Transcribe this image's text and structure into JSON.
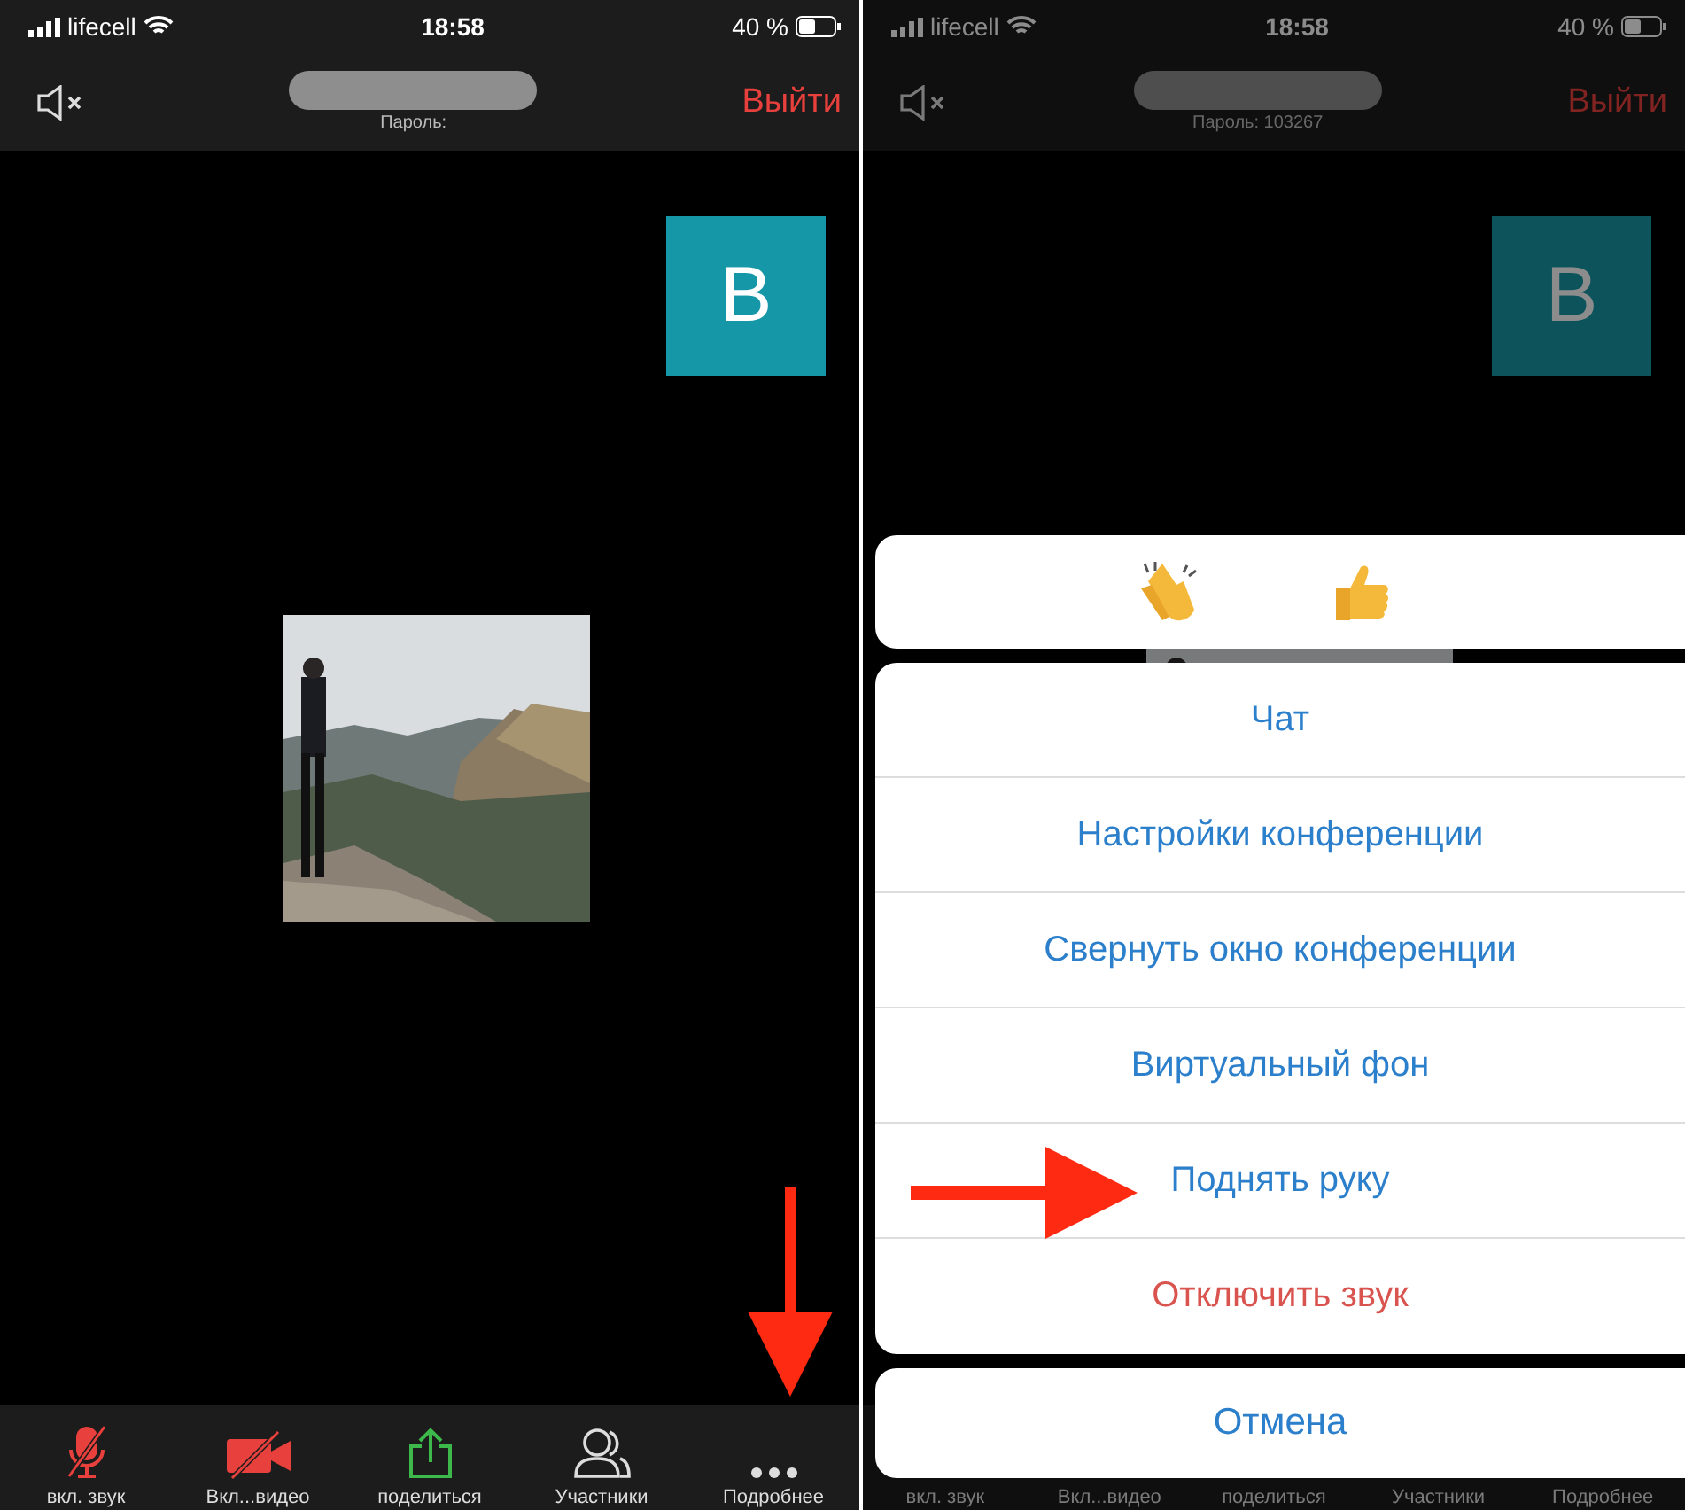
{
  "screens": [
    {
      "dimmed": false,
      "status": {
        "carrier": "lifecell",
        "time": "18:58",
        "battery": "40 %"
      },
      "header": {
        "password": "Пароль:",
        "leave": "Выйти"
      },
      "tile": {
        "initial": "B"
      },
      "toolbar": [
        {
          "kind": "mic",
          "label": "вкл. звук"
        },
        {
          "kind": "video",
          "label": "Вкл...видео"
        },
        {
          "kind": "share",
          "label": "поделиться"
        },
        {
          "kind": "people",
          "label": "Участники"
        },
        {
          "kind": "more",
          "label": "Подробнее"
        }
      ],
      "arrow": {
        "kind": "down"
      }
    },
    {
      "dimmed": true,
      "status": {
        "carrier": "lifecell",
        "time": "18:58",
        "battery": "40 %"
      },
      "header": {
        "password": "Пароль: 103267",
        "leave": "Выйти"
      },
      "tile": {
        "initial": "B"
      },
      "toolbar": [
        {
          "label": "вкл. звук"
        },
        {
          "label": "Вкл...видео"
        },
        {
          "label": "поделиться"
        },
        {
          "label": "Участники"
        },
        {
          "label": "Подробнее"
        }
      ],
      "menu": {
        "reactions": [
          {
            "kind": "clap"
          },
          {
            "kind": "thumbs_up"
          }
        ],
        "items": [
          {
            "label": "Чат",
            "kind": "normal"
          },
          {
            "label": "Настройки конференции",
            "kind": "normal"
          },
          {
            "label": "Свернуть окно конференции",
            "kind": "normal"
          },
          {
            "label": "Виртуальный фон",
            "kind": "normal"
          },
          {
            "label": "Поднять руку",
            "kind": "normal"
          },
          {
            "label": "Отключить звук",
            "kind": "destructive"
          }
        ],
        "cancel": "Отмена"
      },
      "arrow": {
        "kind": "right"
      }
    }
  ]
}
